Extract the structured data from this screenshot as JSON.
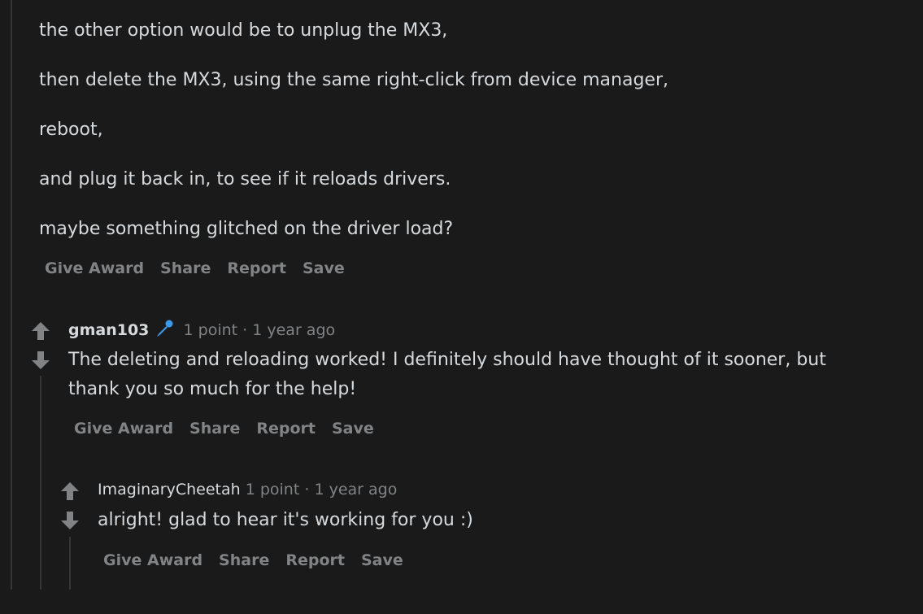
{
  "parent_comment": {
    "paragraphs": [
      "the other option would be to unplug the MX3,",
      "then delete the MX3, using the same right-click from device manager,",
      "reboot,",
      "and plug it back in, to see if it reloads drivers.",
      "maybe something glitched on the driver load?"
    ],
    "actions": [
      "Give Award",
      "Share",
      "Report",
      "Save"
    ]
  },
  "reply1": {
    "username": "gman103",
    "flair_icon": "microphone-icon",
    "points": "1 point",
    "separator": "·",
    "time": "1 year ago",
    "body": "The deleting and reloading worked! I definitely should have thought of it sooner, but thank you so much for the help!",
    "actions": [
      "Give Award",
      "Share",
      "Report",
      "Save"
    ]
  },
  "reply2": {
    "username": "ImaginaryCheetah",
    "points": "1 point",
    "separator": "·",
    "time": "1 year ago",
    "body": "alright! glad to hear it's working for you :)",
    "actions": [
      "Give Award",
      "Share",
      "Report",
      "Save"
    ]
  },
  "colors": {
    "background": "#1a1a1b",
    "text": "#d7dadc",
    "muted": "#818384",
    "thread_line": "#343536",
    "flair": "#3b9ae8"
  }
}
